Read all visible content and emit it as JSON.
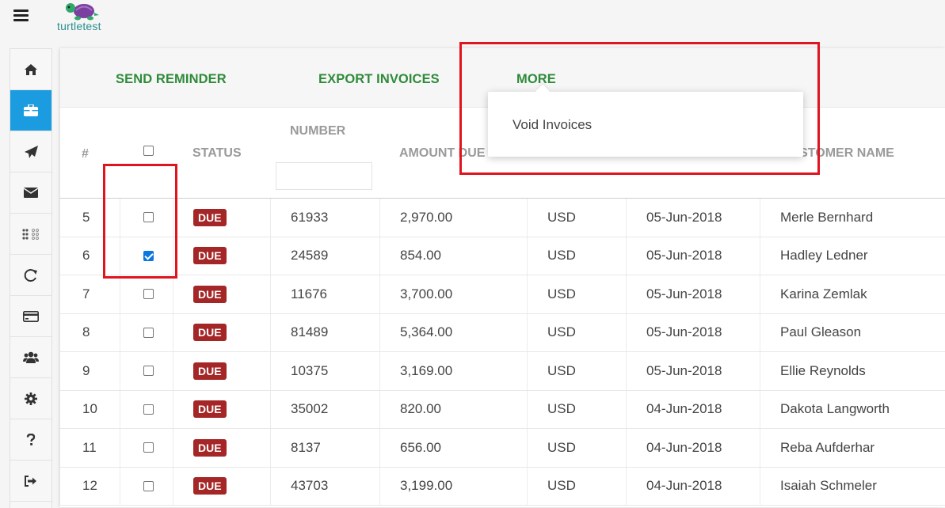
{
  "brand": {
    "logo_text": "turtletest"
  },
  "sidebar": {
    "items": [
      {
        "icon": "home-icon",
        "active": false
      },
      {
        "icon": "briefcase-icon",
        "active": true
      },
      {
        "icon": "paper-plane-icon",
        "active": false
      },
      {
        "icon": "envelope-icon",
        "active": false
      },
      {
        "icon": "dots-grid-icon",
        "active": false
      },
      {
        "icon": "refresh-icon",
        "active": false
      },
      {
        "icon": "credit-card-icon",
        "active": false
      },
      {
        "icon": "users-icon",
        "active": false
      },
      {
        "icon": "gear-icon",
        "active": false
      },
      {
        "icon": "help-icon",
        "active": false
      },
      {
        "icon": "sign-out-icon",
        "active": false
      }
    ]
  },
  "toolbar": {
    "send_reminder": "SEND REMINDER",
    "export_invoices": "EXPORT INVOICES",
    "more": "MORE"
  },
  "dropdown": {
    "void_invoices": "Void Invoices"
  },
  "table": {
    "headers": {
      "index": "#",
      "status": "STATUS",
      "number": "NUMBER",
      "amount_due": "AMOUNT DUE",
      "customer_name": "CUSTOMER NAME"
    },
    "rows": [
      {
        "index": "5",
        "checked": false,
        "status": "DUE",
        "number": "61933",
        "amount": "2,970.00",
        "currency": "USD",
        "date": "05-Jun-2018",
        "customer": "Merle Bernhard"
      },
      {
        "index": "6",
        "checked": true,
        "status": "DUE",
        "number": "24589",
        "amount": "854.00",
        "currency": "USD",
        "date": "05-Jun-2018",
        "customer": "Hadley Ledner"
      },
      {
        "index": "7",
        "checked": false,
        "status": "DUE",
        "number": "11676",
        "amount": "3,700.00",
        "currency": "USD",
        "date": "05-Jun-2018",
        "customer": "Karina Zemlak"
      },
      {
        "index": "8",
        "checked": false,
        "status": "DUE",
        "number": "81489",
        "amount": "5,364.00",
        "currency": "USD",
        "date": "05-Jun-2018",
        "customer": "Paul Gleason"
      },
      {
        "index": "9",
        "checked": false,
        "status": "DUE",
        "number": "10375",
        "amount": "3,169.00",
        "currency": "USD",
        "date": "05-Jun-2018",
        "customer": "Ellie Reynolds"
      },
      {
        "index": "10",
        "checked": false,
        "status": "DUE",
        "number": "35002",
        "amount": "820.00",
        "currency": "USD",
        "date": "04-Jun-2018",
        "customer": "Dakota Langworth"
      },
      {
        "index": "11",
        "checked": false,
        "status": "DUE",
        "number": "8137",
        "amount": "656.00",
        "currency": "USD",
        "date": "04-Jun-2018",
        "customer": "Reba Aufderhar"
      },
      {
        "index": "12",
        "checked": false,
        "status": "DUE",
        "number": "43703",
        "amount": "3,199.00",
        "currency": "USD",
        "date": "04-Jun-2018",
        "customer": "Isaiah Schmeler"
      }
    ]
  },
  "colors": {
    "accent_green": "#2e8b3a",
    "sidebar_active": "#1b9be0",
    "badge_due": "#a52626",
    "highlight": "#e0141e"
  }
}
